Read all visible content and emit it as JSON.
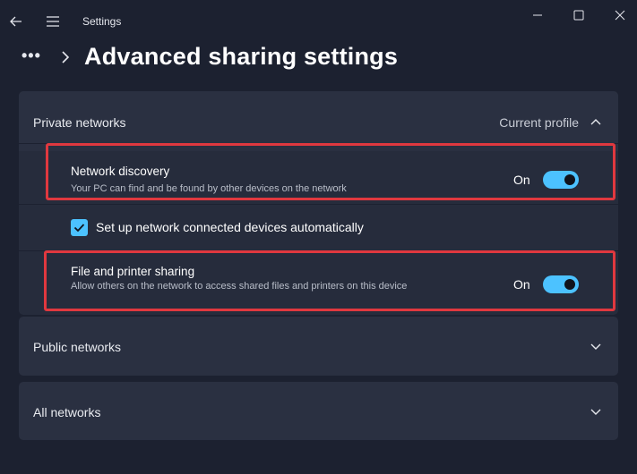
{
  "titlebar": {
    "app_title": "Settings"
  },
  "header": {
    "overflow": "•••",
    "page_title": "Advanced sharing settings"
  },
  "private_networks": {
    "label": "Private networks",
    "profile_badge": "Current profile",
    "network_discovery": {
      "title": "Network discovery",
      "description": "Your PC can find and be found by other devices on the network",
      "state": "On",
      "enabled": true
    },
    "auto_setup": {
      "label": "Set up network connected devices automatically",
      "checked": true
    },
    "file_printer_sharing": {
      "title": "File and printer sharing",
      "description": "Allow others on the network to access shared files and printers on this device",
      "state": "On",
      "enabled": true
    }
  },
  "public_networks": {
    "label": "Public networks"
  },
  "all_networks": {
    "label": "All networks"
  },
  "colors": {
    "background": "#1c2130",
    "card": "#2a3041",
    "accent": "#4cc2ff",
    "highlight": "#e0383f"
  },
  "icons": [
    "back-arrow-icon",
    "hamburger-menu-icon",
    "minimize-icon",
    "maximize-icon",
    "close-icon",
    "chevron-right-icon",
    "chevron-up-icon",
    "chevron-down-icon",
    "checkmark-icon"
  ]
}
